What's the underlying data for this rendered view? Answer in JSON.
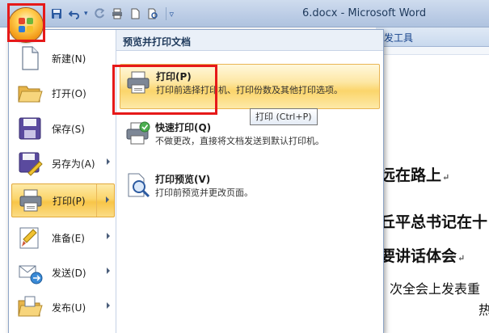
{
  "window": {
    "title": "6.docx - Microsoft Word"
  },
  "quick_access": {
    "icons": [
      "save-icon",
      "undo-icon",
      "redo-icon",
      "print-icon",
      "new-document-icon",
      "print-preview-icon",
      "customize-dropdown-icon"
    ],
    "undo_dropdown": "▾",
    "customize": "▿"
  },
  "ribbon": {
    "tab_partial": "发工具"
  },
  "document": {
    "lines": [
      {
        "text": "远在路上",
        "mark": "↵"
      },
      {
        "text": "丘平总书记在十"
      },
      {
        "text": "要讲话体会",
        "mark": "↵"
      },
      {
        "text": "次全会上发表重"
      },
      {
        "text": "热"
      }
    ]
  },
  "office_menu": {
    "left_items": [
      {
        "label": "新建(N)",
        "icon": "new-document-icon",
        "has_submenu": false
      },
      {
        "label": "打开(O)",
        "icon": "open-folder-icon",
        "has_submenu": false
      },
      {
        "label": "保存(S)",
        "icon": "save-icon",
        "has_submenu": false
      },
      {
        "label": "另存为(A)",
        "icon": "save-as-icon",
        "has_submenu": true
      },
      {
        "label": "打印(P)",
        "icon": "printer-icon",
        "has_submenu": true,
        "active": true
      },
      {
        "label": "准备(E)",
        "icon": "prepare-icon",
        "has_submenu": true
      },
      {
        "label": "发送(D)",
        "icon": "send-icon",
        "has_submenu": true
      },
      {
        "label": "发布(U)",
        "icon": "publish-icon",
        "has_submenu": true
      }
    ],
    "right_panel": {
      "header": "预览并打印文档",
      "items": [
        {
          "title": "打印(P)",
          "desc": "打印前选择打印机、打印份数及其他打印选项。",
          "icon": "printer-icon",
          "active": true
        },
        {
          "title": "快速打印(Q)",
          "desc": "不做更改，直接将文档发送到默认打印机。",
          "icon": "quick-print-icon"
        },
        {
          "title": "打印预览(V)",
          "desc": "打印前预览并更改页面。",
          "icon": "print-preview-icon"
        }
      ]
    }
  },
  "tooltip": {
    "text": "打印 (Ctrl+P)"
  },
  "colors": {
    "highlight_box": "#e61919",
    "active_item": "#fbd56b",
    "title_text": "#1e395b"
  }
}
